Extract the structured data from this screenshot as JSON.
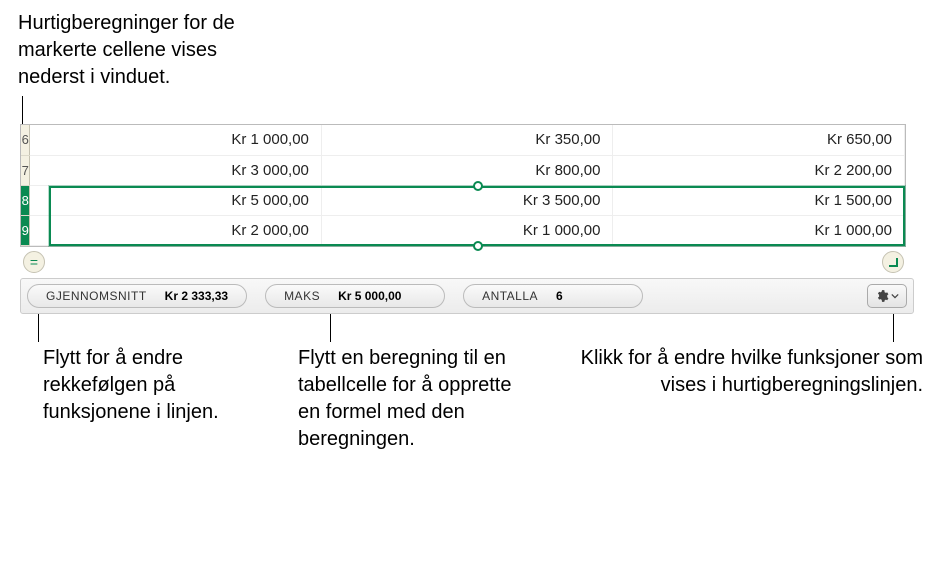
{
  "callouts": {
    "top": "Hurtigberegninger for de\nmarkerte cellene vises\nnederst i vinduet.",
    "bottom1": "Flytt for å endre rekkefølgen på funksjonene i linjen.",
    "bottom2": "Flytt en beregning til en tabellcelle for å opprette en formel med den beregningen.",
    "bottom3": "Klikk for å endre hvilke funksjoner som vises i hurtigberegningslinjen."
  },
  "table": {
    "rows": [
      {
        "num": "6",
        "selected": false,
        "cells": [
          "Kr 1 000,00",
          "Kr 350,00",
          "Kr 650,00"
        ]
      },
      {
        "num": "7",
        "selected": false,
        "cells": [
          "Kr 3 000,00",
          "Kr 800,00",
          "Kr 2 200,00"
        ]
      },
      {
        "num": "8",
        "selected": true,
        "cells": [
          "Kr 5 000,00",
          "Kr 3 500,00",
          "Kr 1 500,00"
        ]
      },
      {
        "num": "9",
        "selected": true,
        "cells": [
          "Kr 2 000,00",
          "Kr 1 000,00",
          "Kr 1 000,00"
        ]
      }
    ]
  },
  "calc_bar": {
    "pills": [
      {
        "label": "GJENNOMSNITT",
        "value": "Kr 2 333,33"
      },
      {
        "label": "MAKS",
        "value": "Kr 5 000,00"
      },
      {
        "label": "ANTALLA",
        "value": "6"
      }
    ]
  }
}
